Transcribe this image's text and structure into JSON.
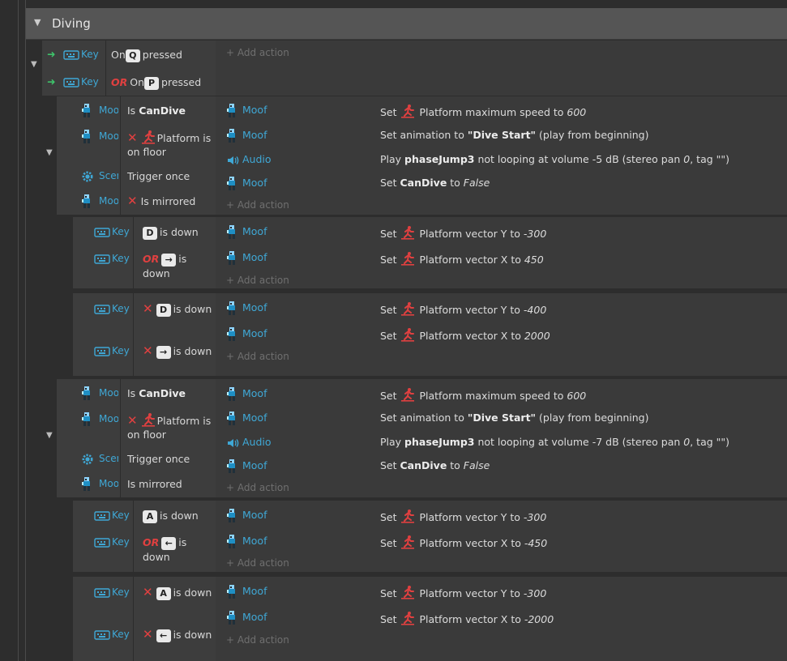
{
  "group": {
    "title": "Diving"
  },
  "colors": {
    "accent": "#3fa8d6",
    "negation": "#e04040",
    "or": "#e04040",
    "green": "#3ec36a"
  },
  "labels": {
    "add_action": "Add action",
    "or": "OR"
  },
  "events": [
    {
      "id": "ev1",
      "conditions": [
        {
          "obj": "Key",
          "parts": [
            {
              "t": "On"
            },
            {
              "k": "Q"
            },
            {
              "t": "pressed"
            }
          ]
        },
        {
          "obj": "Key",
          "parts": [
            {
              "or": "OR"
            },
            {
              "t": "On"
            },
            {
              "k": "P"
            },
            {
              "t": "pressed"
            }
          ]
        }
      ],
      "actions": []
    },
    {
      "id": "ev2",
      "conditions": [
        {
          "obj": "Moof",
          "parts": [
            {
              "t": "Is "
            },
            {
              "b": "CanDive"
            }
          ]
        },
        {
          "obj": "Moof",
          "parts": [
            {
              "x": "✕"
            },
            {
              "i": "platform"
            },
            {
              "t": "Platform is on floor"
            }
          ]
        },
        {
          "obj": "Scene",
          "parts": [
            {
              "t": "Trigger once"
            }
          ]
        },
        {
          "obj": "Moof",
          "parts": [
            {
              "x": "✕"
            },
            {
              "t": "Is mirrored"
            }
          ]
        }
      ],
      "actions": [
        {
          "obj": "Moof",
          "icon": "moof",
          "parts": [
            {
              "t": "Set "
            },
            {
              "i": "platform"
            },
            {
              "t": " Platform maximum speed to "
            },
            {
              "em": "600"
            }
          ]
        },
        {
          "obj": "Moof",
          "icon": "moof",
          "parts": [
            {
              "t": "Set animation to "
            },
            {
              "b": "\"Dive Start\""
            },
            {
              "t": " (play from beginning)"
            }
          ]
        },
        {
          "obj": "Audio",
          "icon": "audio",
          "parts": [
            {
              "t": "Play "
            },
            {
              "b": "phaseJump3"
            },
            {
              "t": " not looping at volume -5 dB (stereo pan "
            },
            {
              "em": "0"
            },
            {
              "t": ", tag \"\")"
            }
          ]
        },
        {
          "obj": "Moof",
          "icon": "moof",
          "parts": [
            {
              "t": "Set "
            },
            {
              "b": "CanDive"
            },
            {
              "t": " to "
            },
            {
              "em": "False"
            }
          ]
        }
      ]
    },
    {
      "id": "ev3",
      "conditions": [
        {
          "obj": "Key",
          "parts": [
            {
              "k": "D"
            },
            {
              "t": "is down"
            }
          ]
        },
        {
          "obj": "Key",
          "parts": [
            {
              "or": "OR"
            },
            {
              "k": "→"
            },
            {
              "t": "is down"
            }
          ]
        }
      ],
      "actions": [
        {
          "obj": "Moof",
          "icon": "moof",
          "parts": [
            {
              "t": "Set "
            },
            {
              "i": "platform"
            },
            {
              "t": " Platform vector Y to "
            },
            {
              "em": "-300"
            }
          ]
        },
        {
          "obj": "Moof",
          "icon": "moof",
          "parts": [
            {
              "t": "Set "
            },
            {
              "i": "platform"
            },
            {
              "t": " Platform vector X to "
            },
            {
              "em": "450"
            }
          ]
        }
      ]
    },
    {
      "id": "ev4",
      "conditions": [
        {
          "obj": "Key",
          "parts": [
            {
              "x": "✕"
            },
            {
              "k": "D"
            },
            {
              "t": "is down"
            }
          ]
        },
        {
          "obj": "Key",
          "parts": [
            {
              "x": "✕"
            },
            {
              "k": "→"
            },
            {
              "t": "is down"
            }
          ]
        }
      ],
      "actions": [
        {
          "obj": "Moof",
          "icon": "moof",
          "parts": [
            {
              "t": "Set "
            },
            {
              "i": "platform"
            },
            {
              "t": " Platform vector Y to "
            },
            {
              "em": "-400"
            }
          ]
        },
        {
          "obj": "Moof",
          "icon": "moof",
          "parts": [
            {
              "t": "Set "
            },
            {
              "i": "platform"
            },
            {
              "t": " Platform vector X to "
            },
            {
              "em": "2000"
            }
          ]
        }
      ]
    },
    {
      "id": "ev5",
      "conditions": [
        {
          "obj": "Moof",
          "parts": [
            {
              "t": "Is "
            },
            {
              "b": "CanDive"
            }
          ]
        },
        {
          "obj": "Moof",
          "parts": [
            {
              "x": "✕"
            },
            {
              "i": "platform"
            },
            {
              "t": "Platform is on floor"
            }
          ]
        },
        {
          "obj": "Scene",
          "parts": [
            {
              "t": "Trigger once"
            }
          ]
        },
        {
          "obj": "Moof",
          "parts": [
            {
              "t": "Is mirrored"
            }
          ]
        }
      ],
      "actions": [
        {
          "obj": "Moof",
          "icon": "moof",
          "parts": [
            {
              "t": "Set "
            },
            {
              "i": "platform"
            },
            {
              "t": " Platform maximum speed to "
            },
            {
              "em": "600"
            }
          ]
        },
        {
          "obj": "Moof",
          "icon": "moof",
          "parts": [
            {
              "t": "Set animation to "
            },
            {
              "b": "\"Dive Start\""
            },
            {
              "t": " (play from beginning)"
            }
          ]
        },
        {
          "obj": "Audio",
          "icon": "audio",
          "parts": [
            {
              "t": "Play "
            },
            {
              "b": "phaseJump3"
            },
            {
              "t": " not looping at volume -7 dB (stereo pan "
            },
            {
              "em": "0"
            },
            {
              "t": ", tag \"\")"
            }
          ]
        },
        {
          "obj": "Moof",
          "icon": "moof",
          "parts": [
            {
              "t": "Set "
            },
            {
              "b": "CanDive"
            },
            {
              "t": " to "
            },
            {
              "em": "False"
            }
          ]
        }
      ]
    },
    {
      "id": "ev6",
      "conditions": [
        {
          "obj": "Key",
          "parts": [
            {
              "k": "A"
            },
            {
              "t": "is down"
            }
          ]
        },
        {
          "obj": "Key",
          "parts": [
            {
              "or": "OR"
            },
            {
              "k": "←"
            },
            {
              "t": "is down"
            }
          ]
        }
      ],
      "actions": [
        {
          "obj": "Moof",
          "icon": "moof",
          "parts": [
            {
              "t": "Set "
            },
            {
              "i": "platform"
            },
            {
              "t": " Platform vector Y to "
            },
            {
              "em": "-300"
            }
          ]
        },
        {
          "obj": "Moof",
          "icon": "moof",
          "parts": [
            {
              "t": "Set "
            },
            {
              "i": "platform"
            },
            {
              "t": " Platform vector X to "
            },
            {
              "em": "-450"
            }
          ]
        }
      ]
    },
    {
      "id": "ev7",
      "conditions": [
        {
          "obj": "Key",
          "parts": [
            {
              "x": "✕"
            },
            {
              "k": "A"
            },
            {
              "t": "is down"
            }
          ]
        },
        {
          "obj": "Key",
          "parts": [
            {
              "x": "✕"
            },
            {
              "k": "←"
            },
            {
              "t": "is down"
            }
          ]
        }
      ],
      "actions": [
        {
          "obj": "Moof",
          "icon": "moof",
          "parts": [
            {
              "t": "Set "
            },
            {
              "i": "platform"
            },
            {
              "t": " Platform vector Y to "
            },
            {
              "em": "-300"
            }
          ]
        },
        {
          "obj": "Moof",
          "icon": "moof",
          "parts": [
            {
              "t": "Set "
            },
            {
              "i": "platform"
            },
            {
              "t": " Platform vector X to "
            },
            {
              "em": "-2000"
            }
          ]
        }
      ]
    }
  ]
}
